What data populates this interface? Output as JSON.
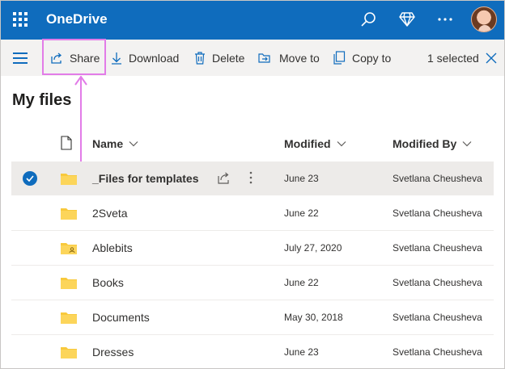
{
  "header": {
    "app_name": "OneDrive",
    "bg_color": "#0f6cbd",
    "icons": [
      "app-launcher-icon",
      "search-icon",
      "premium-diamond-icon",
      "more-icon",
      "avatar"
    ]
  },
  "commandbar": {
    "share": "Share",
    "download": "Download",
    "delete": "Delete",
    "move_to": "Move to",
    "copy_to": "Copy to",
    "selected": "1 selected"
  },
  "page": {
    "title": "My files"
  },
  "columns": {
    "name": "Name",
    "modified": "Modified",
    "modified_by": "Modified By"
  },
  "rows": [
    {
      "name": "_Files for templates",
      "modified": "June 23",
      "modified_by": "Svetlana Cheusheva",
      "selected": true,
      "shared": false
    },
    {
      "name": "2Sveta",
      "modified": "June 22",
      "modified_by": "Svetlana Cheusheva",
      "selected": false,
      "shared": false
    },
    {
      "name": "Ablebits",
      "modified": "July 27, 2020",
      "modified_by": "Svetlana Cheusheva",
      "selected": false,
      "shared": true
    },
    {
      "name": "Books",
      "modified": "June 22",
      "modified_by": "Svetlana Cheusheva",
      "selected": false,
      "shared": false
    },
    {
      "name": "Documents",
      "modified": "May 30, 2018",
      "modified_by": "Svetlana Cheusheva",
      "selected": false,
      "shared": false
    },
    {
      "name": "Dresses",
      "modified": "June 23",
      "modified_by": "Svetlana Cheusheva",
      "selected": false,
      "shared": false
    }
  ],
  "colors": {
    "accent": "#0f6cbd",
    "annotation": "#e27ce8",
    "folder": "#f8c93c",
    "selected_row": "#edebe9"
  }
}
